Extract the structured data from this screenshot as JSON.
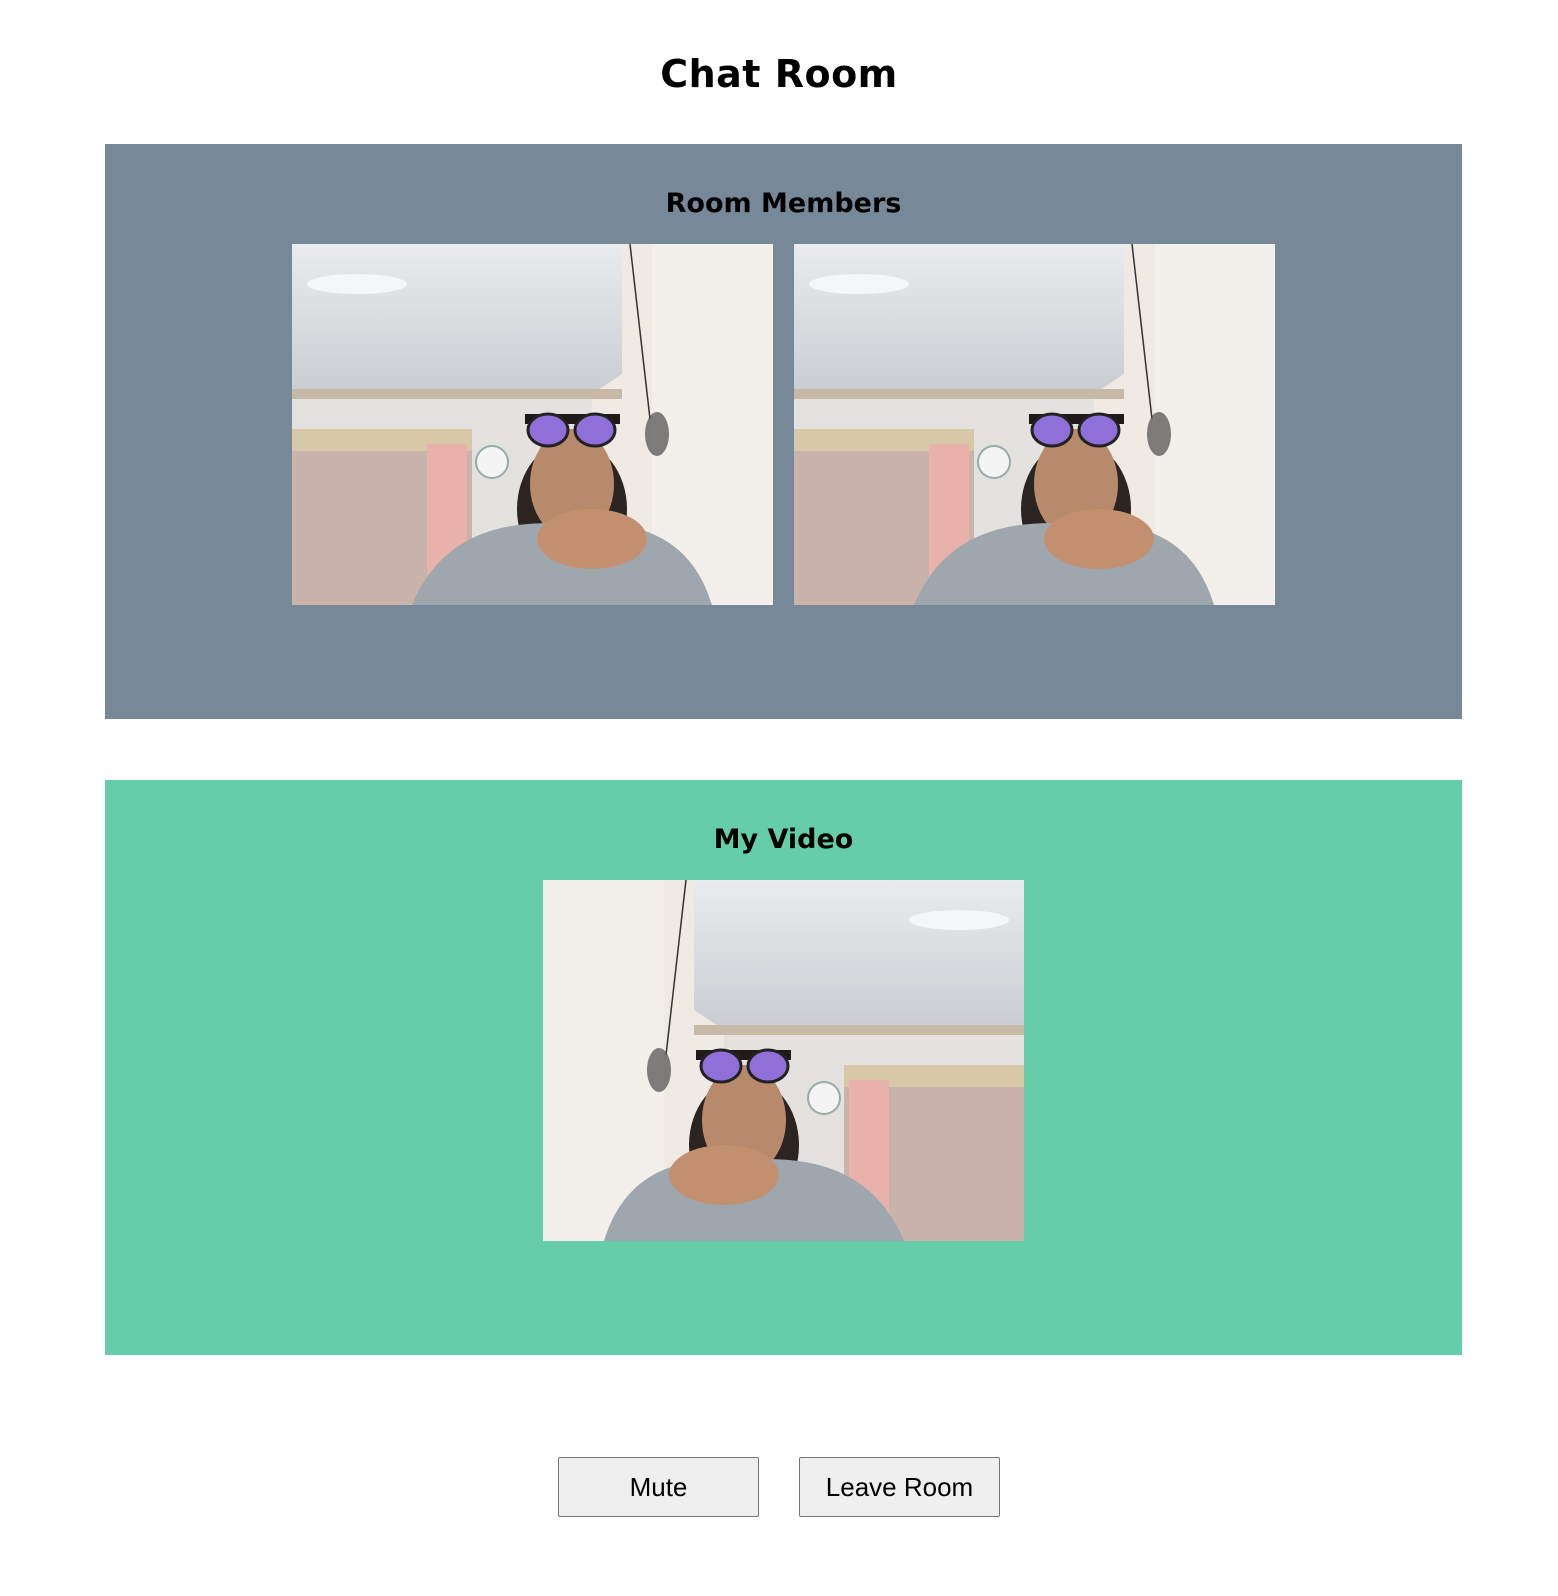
{
  "page": {
    "title": "Chat Room"
  },
  "room_members": {
    "heading": "Room Members",
    "background_color": "#778899",
    "videos": [
      {
        "kind": "remote-video",
        "mirrored": false
      },
      {
        "kind": "remote-video",
        "mirrored": false
      }
    ]
  },
  "my_video": {
    "heading": "My Video",
    "background_color": "#66cdaa",
    "video": {
      "kind": "local-video",
      "mirrored": true
    }
  },
  "controls": {
    "mute_label": "Mute",
    "leave_label": "Leave Room"
  }
}
